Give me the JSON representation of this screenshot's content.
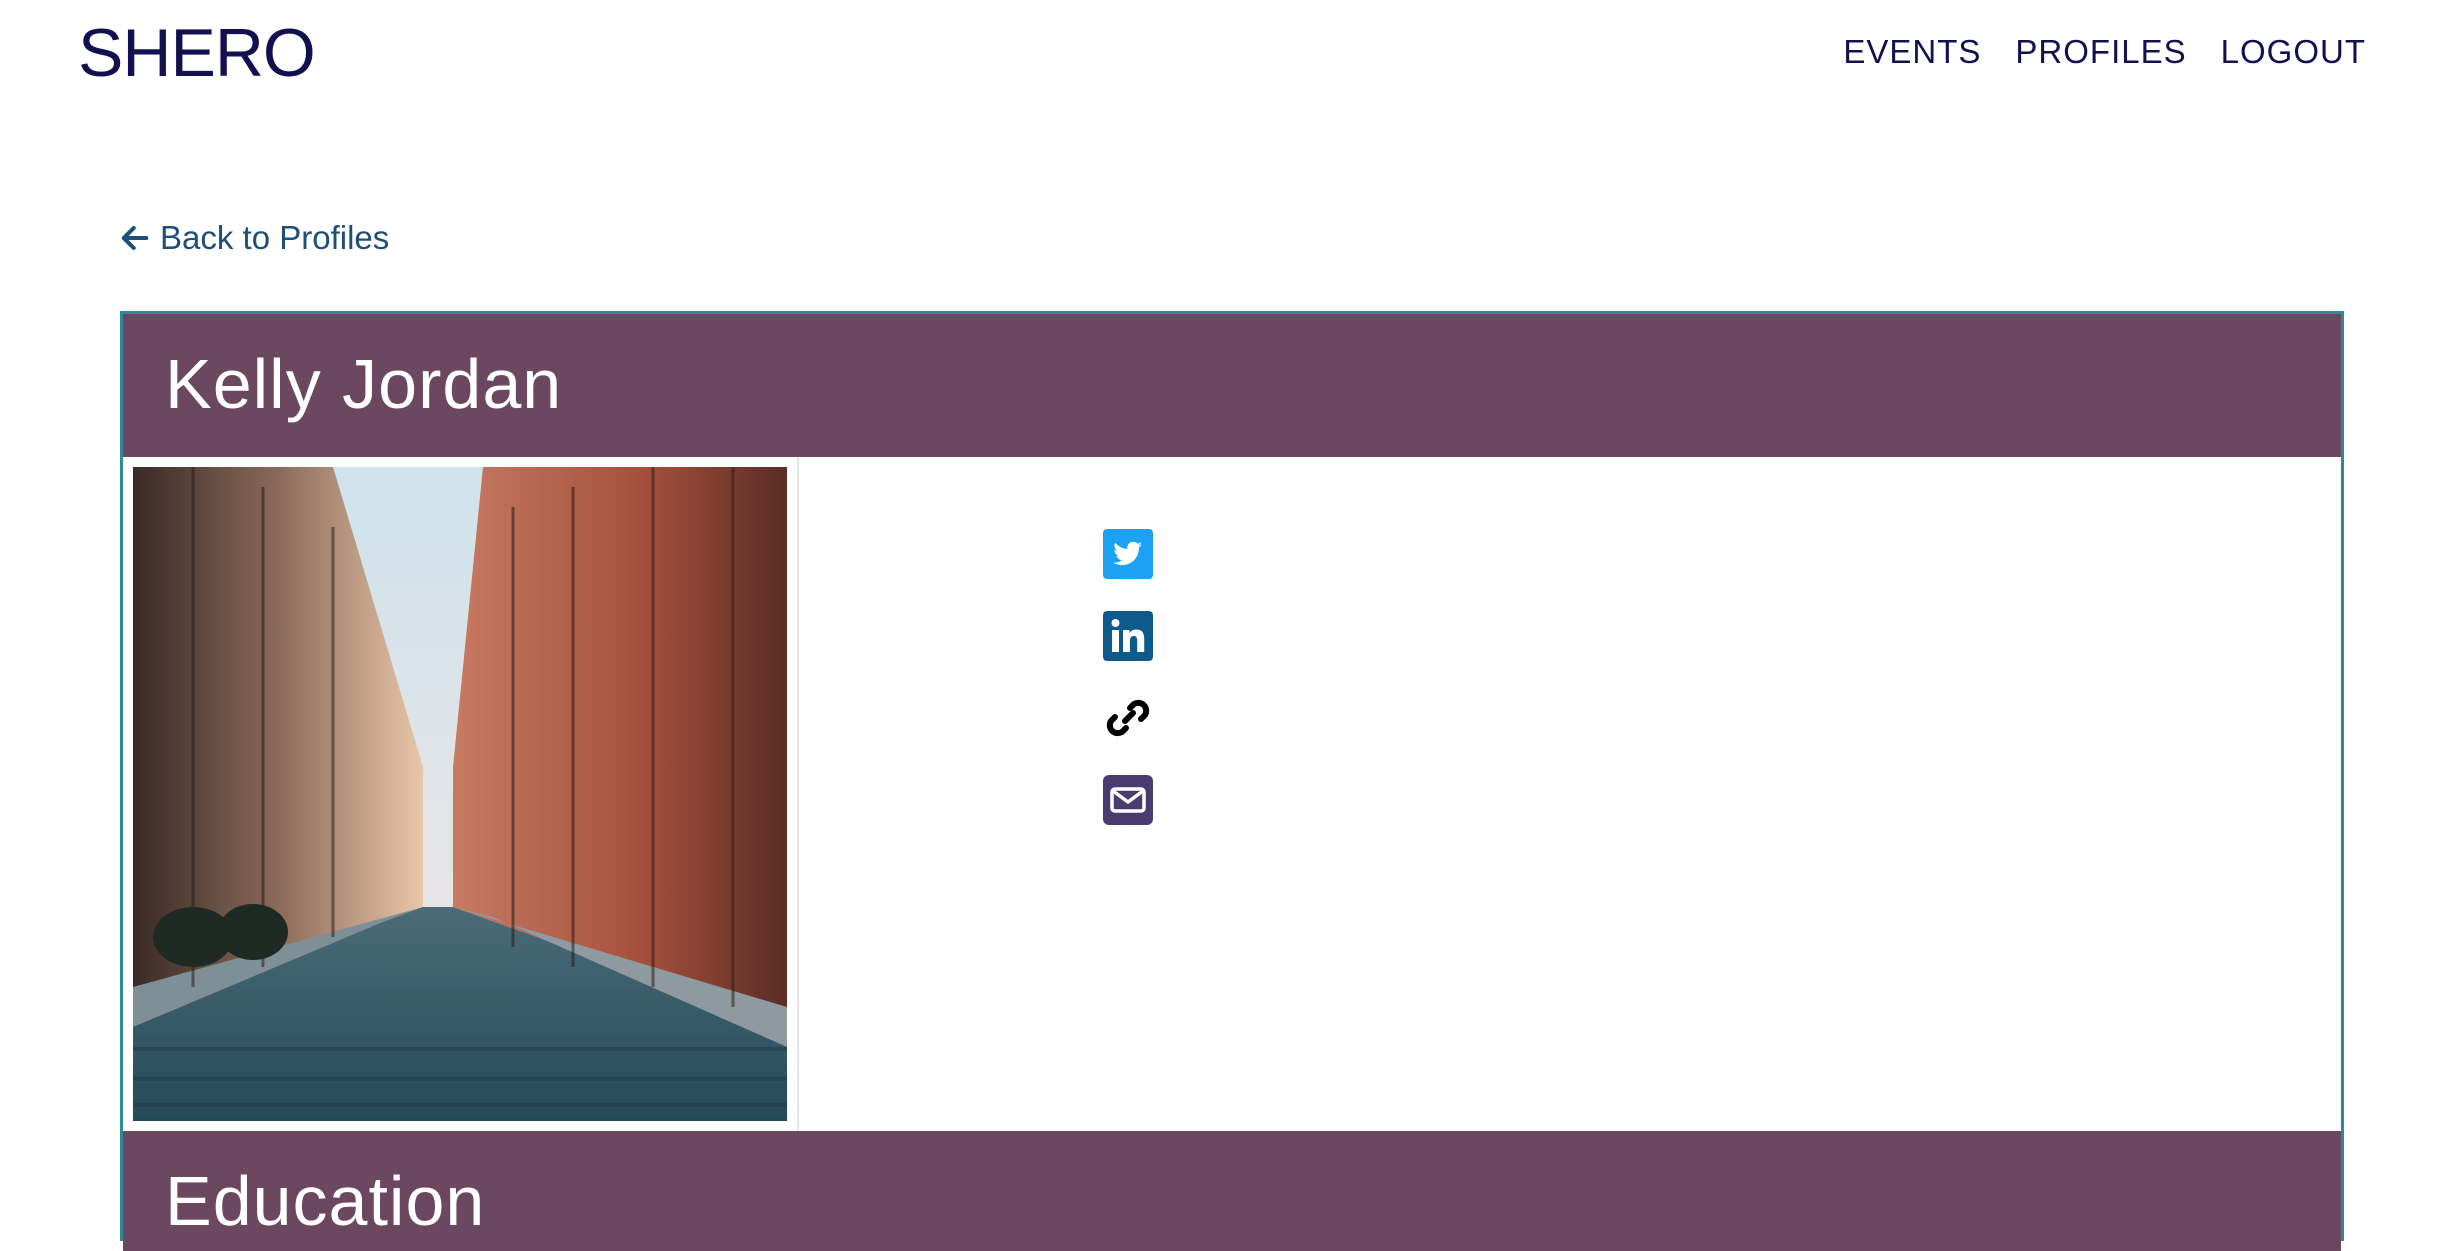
{
  "header": {
    "brand": "SHERO",
    "nav": [
      {
        "label": "EVENTS"
      },
      {
        "label": "PROFILES"
      },
      {
        "label": "LOGOUT"
      }
    ]
  },
  "back_link": {
    "label": "Back to Profiles",
    "icon": "arrow-left-icon"
  },
  "profile": {
    "name": "Kelly Jordan",
    "photo_description": "city-street-photo",
    "social_links": [
      {
        "icon": "twitter-icon",
        "color": "#1da1f2"
      },
      {
        "icon": "linkedin-icon",
        "color": "#0e5a8a"
      },
      {
        "icon": "link-icon",
        "color": "#000000"
      },
      {
        "icon": "email-icon",
        "color": "#4a3c6e"
      }
    ]
  },
  "sections": {
    "education_title": "Education"
  },
  "colors": {
    "brand": "#12104f",
    "header_bg": "#6b4860",
    "card_border": "#2b8a9b",
    "link": "#1f4e79"
  }
}
